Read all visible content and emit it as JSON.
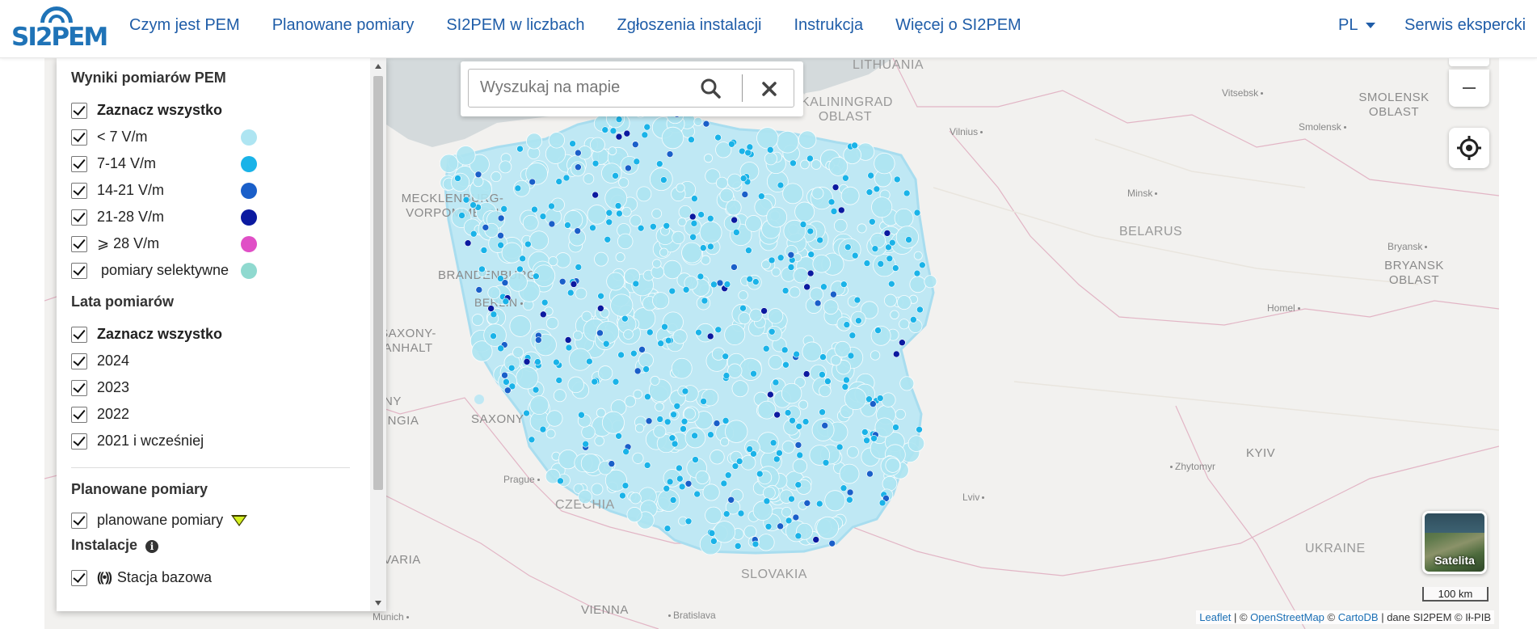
{
  "brand": {
    "logo_text": "SI2PEM"
  },
  "nav": {
    "items": [
      "Czym jest PEM",
      "Planowane pomiary",
      "SI2PEM w liczbach",
      "Zgłoszenia instalacji",
      "Instrukcja",
      "Więcej o SI2PEM"
    ],
    "lang": "PL",
    "expert": "Serwis ekspercki"
  },
  "sidebar": {
    "results_title": "Wyniki pomiarów PEM",
    "results_select_all": "Zaznacz wszystko",
    "ranges": [
      {
        "label": "< 7 V/m",
        "color": "#aee5f2"
      },
      {
        "label": "7-14 V/m",
        "color": "#1ab3e8"
      },
      {
        "label": "14-21 V/m",
        "color": "#1a5fc9"
      },
      {
        "label": "21-28 V/m",
        "color": "#0b1aa0"
      },
      {
        "label": "⩾ 28 V/m",
        "color": "#e04fc6"
      },
      {
        "label": " pomiary selektywne",
        "color": "#8fd9cf"
      }
    ],
    "years_title": "Lata pomiarów",
    "years_select_all": "Zaznacz wszystko",
    "years": [
      "2024",
      "2023",
      "2022",
      "2021 i wcześniej"
    ],
    "planned_title": "Planowane pomiary",
    "planned_label": "planowane pomiary",
    "installations_title": "Instalacje",
    "installation_first": "Stacja bazowa"
  },
  "search": {
    "placeholder": "Wyszukaj na mapie"
  },
  "map": {
    "regions": [
      {
        "name": "LITHUANIA"
      },
      {
        "name": "KALININGRAD OBLAST"
      },
      {
        "name": "MECKLENBURG-VORPOMMERN"
      },
      {
        "name": "BRANDENBURG"
      },
      {
        "name": "SAXONY-ANHALT"
      },
      {
        "name": "SAXONY"
      },
      {
        "name": "CZECHIA"
      },
      {
        "name": "SLOVAKIA"
      },
      {
        "name": "BELARUS"
      },
      {
        "name": "UKRAINE"
      },
      {
        "name": "SMOLENSK OBLAST"
      },
      {
        "name": "BRYANSK OBLAST"
      },
      {
        "name": "KYIV"
      },
      {
        "name": "AVARIA"
      },
      {
        "name": "INGIA"
      },
      {
        "name": "NY"
      },
      {
        "name": "VIENNA"
      }
    ],
    "cities": [
      "Vitsebsk",
      "Smolensk",
      "Vilnius",
      "Minsk",
      "Bryansk",
      "Homel",
      "Berlin",
      "Prague",
      "Zhytomyr",
      "Lviv",
      "Bratislava",
      "Munich"
    ],
    "satellite_label": "Satelita",
    "scale_label": "100 km",
    "colors": {
      "water": "#d4dadc",
      "land": "#f2f1ef",
      "poland": "#bfe8f4"
    }
  },
  "attribution": {
    "leaflet": "Leaflet",
    "sep1": " | © ",
    "osm": "OpenStreetMap",
    "sep2": " © ",
    "carto": "CartoDB",
    "rest": " | dane SI2PEM © Ił-PIB"
  }
}
